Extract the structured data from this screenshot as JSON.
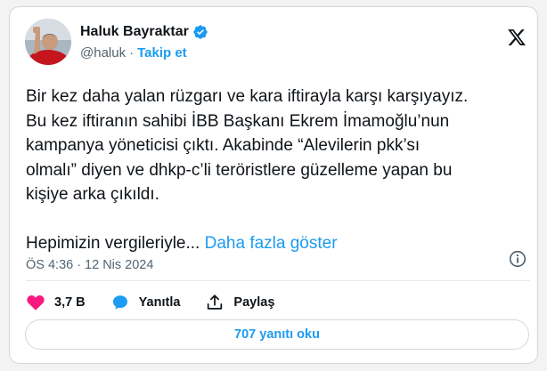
{
  "tweet": {
    "author_name": "Haluk Bayraktar",
    "handle": "@haluk",
    "separator": "·",
    "follow_label": "Takip et",
    "body_lines": [
      "Bir kez daha yalan rüzgarı ve kara iftirayla karşı karşıyayız.",
      "Bu kez iftiranın sahibi İBB Başkanı Ekrem İmamoğlu’nun",
      "kampanya yöneticisi çıktı. Akabinde “Alevilerin pkk’sı",
      "olmalı” diyen ve dhkp-c’li teröristlere güzelleme yapan bu",
      "kişiye arka çıkıldı."
    ],
    "last_line": "Hepimizin vergileriyle...",
    "show_more": "Daha fazla göster",
    "time": "ÖS 4:36",
    "date": "12 Nis 2024",
    "likes": "3,7 B",
    "reply_label": "Yanıtla",
    "share_label": "Paylaş",
    "read_replies": "707 yanıtı oku"
  },
  "icons": {
    "verified": "verified-badge-icon",
    "x_logo": "x-logo-icon",
    "info": "info-icon",
    "like": "heart-icon",
    "reply": "speech-bubble-icon",
    "share": "share-upload-icon"
  },
  "colors": {
    "accent": "#1d9bf0",
    "like": "#f91880",
    "muted": "#536471",
    "text": "#0f1419"
  }
}
